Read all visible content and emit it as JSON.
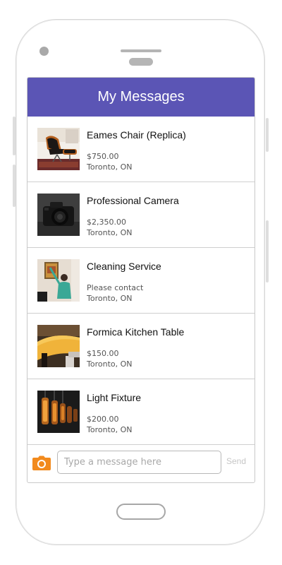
{
  "header": {
    "title": "My Messages"
  },
  "listings": [
    {
      "title": "Eames Chair (Replica)",
      "price": "$750.00",
      "location": "Toronto, ON",
      "image": "chair-photo"
    },
    {
      "title": "Professional Camera",
      "price": "$2,350.00",
      "location": "Toronto, ON",
      "image": "camera-photo"
    },
    {
      "title": "Cleaning Service",
      "price": "Please contact",
      "location": "Toronto, ON",
      "image": "cleaning-photo"
    },
    {
      "title": "Formica Kitchen Table",
      "price": "$150.00",
      "location": "Toronto, ON",
      "image": "table-photo"
    },
    {
      "title": "Light Fixture",
      "price": "$200.00",
      "location": "Toronto, ON",
      "image": "light-fixture-photo"
    }
  ],
  "composer": {
    "placeholder": "Type a message here",
    "send_label": "Send",
    "camera_icon": "camera-icon"
  },
  "colors": {
    "header": "#5b55b5",
    "camera_icon": "#f28a1d"
  }
}
